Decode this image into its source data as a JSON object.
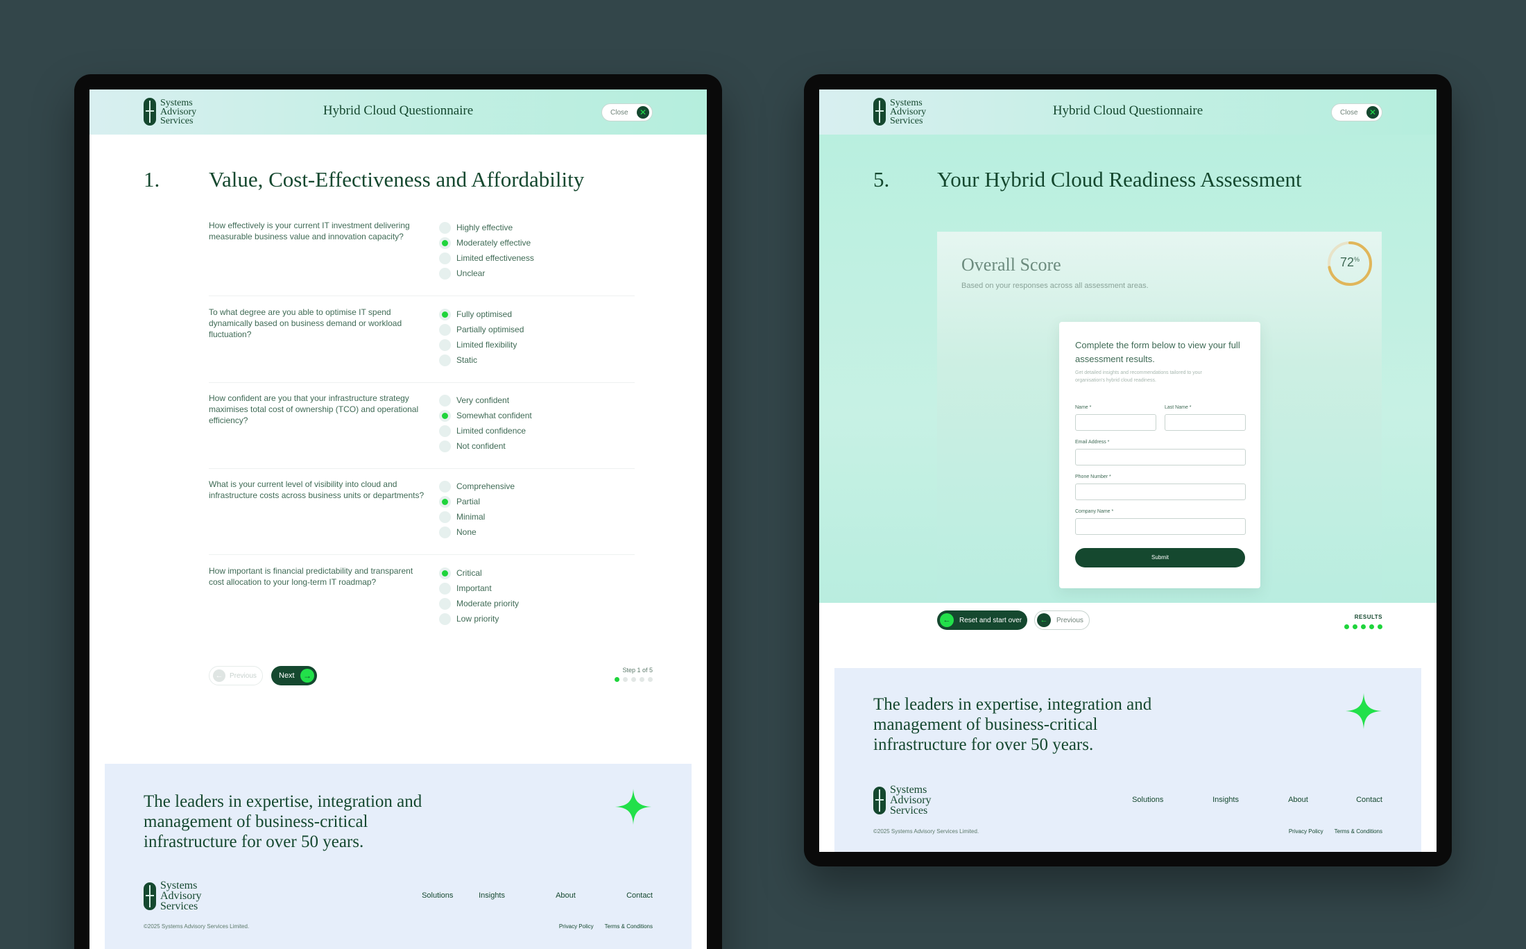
{
  "colors": {
    "brand_dark": "#15482f",
    "accent_green": "#1fd43c",
    "background": "#33464a",
    "footer_bg": "#e6eefa"
  },
  "brand": {
    "line1": "Systems",
    "line2": "Advisory",
    "line3": "Services"
  },
  "header": {
    "title": "Hybrid Cloud Questionnaire",
    "close_label": "Close",
    "close_icon": "close-x-icon"
  },
  "left": {
    "section_number": "1.",
    "section_title": "Value, Cost-Effectiveness and Affordability",
    "questions": [
      {
        "text": "How effectively is your current IT investment delivering measurable business value and innovation capacity?",
        "options": [
          "Highly effective",
          "Moderately effective",
          "Limited effectiveness",
          "Unclear"
        ],
        "selected": 1
      },
      {
        "text": "To what degree are you able to optimise IT spend dynamically based on business demand or workload fluctuation?",
        "options": [
          "Fully optimised",
          "Partially optimised",
          "Limited flexibility",
          "Static"
        ],
        "selected": 0
      },
      {
        "text": "How confident are you that your infrastructure strategy maximises total cost of ownership (TCO) and operational efficiency?",
        "options": [
          "Very confident",
          "Somewhat confident",
          "Limited confidence",
          "Not confident"
        ],
        "selected": 1
      },
      {
        "text": "What is your current level of visibility into cloud and infrastructure costs across business units or departments?",
        "options": [
          "Comprehensive",
          "Partial",
          "Minimal",
          "None"
        ],
        "selected": 1
      },
      {
        "text": "How important is financial predictability and transparent cost allocation to your long-term IT roadmap?",
        "options": [
          "Critical",
          "Important",
          "Moderate priority",
          "Low priority"
        ],
        "selected": 0
      }
    ],
    "prev_label": "Previous",
    "next_label": "Next",
    "step_label": "Step 1 of 5",
    "step_current": 1,
    "step_total": 5
  },
  "right": {
    "section_number": "5.",
    "section_title": "Your Hybrid Cloud Readiness Assessment",
    "score_title": "Overall Score",
    "score_sub": "Based on your responses across all assessment areas.",
    "score_value": "72",
    "score_unit": "%",
    "score_fraction": 0.72,
    "form": {
      "title": "Complete the form below to view your full assessment results.",
      "desc": "Get detailed insights and recommendations tailored to your organisation's hybrid cloud readiness.",
      "name_label": "Name *",
      "lastname_label": "Last Name *",
      "email_label": "Email Address *",
      "phone_label": "Phone Number *",
      "company_label": "Company Name *",
      "submit_label": "Submit"
    },
    "reset_label": "Reset and start over",
    "prev_label": "Previous",
    "results_label": "RESULTS"
  },
  "footer": {
    "tagline": "The leaders in expertise, integration and management of business-critical infrastructure for over 50 years.",
    "nav": [
      "Solutions",
      "Insights",
      "About",
      "Contact"
    ],
    "copyright": "©2025 Systems Advisory Services Limited.",
    "privacy": "Privacy Policy",
    "terms": "Terms & Conditions"
  }
}
